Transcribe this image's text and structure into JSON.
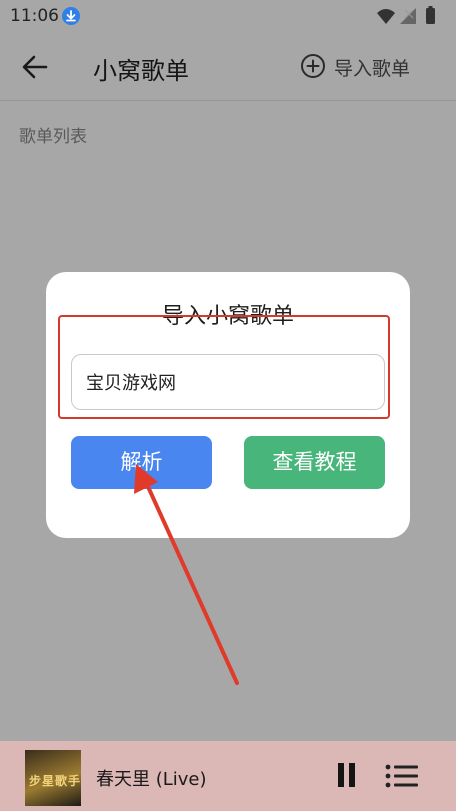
{
  "status_bar": {
    "time": "11:06"
  },
  "app_bar": {
    "title": "小窝歌单",
    "import_label": "导入歌单"
  },
  "section": {
    "label": "歌单列表"
  },
  "dialog": {
    "title": "导入小窝歌单",
    "input_value": "宝贝游戏网",
    "parse_label": "解析",
    "tutorial_label": "查看教程"
  },
  "player": {
    "cover_text": "步星歌手",
    "song_title": "春天里 (Live)"
  },
  "colors": {
    "parse_button": "#4a86f0",
    "tutorial_button": "#48b67a",
    "annotation": "#d33a2c",
    "player_bar": "#dbb8b5"
  }
}
